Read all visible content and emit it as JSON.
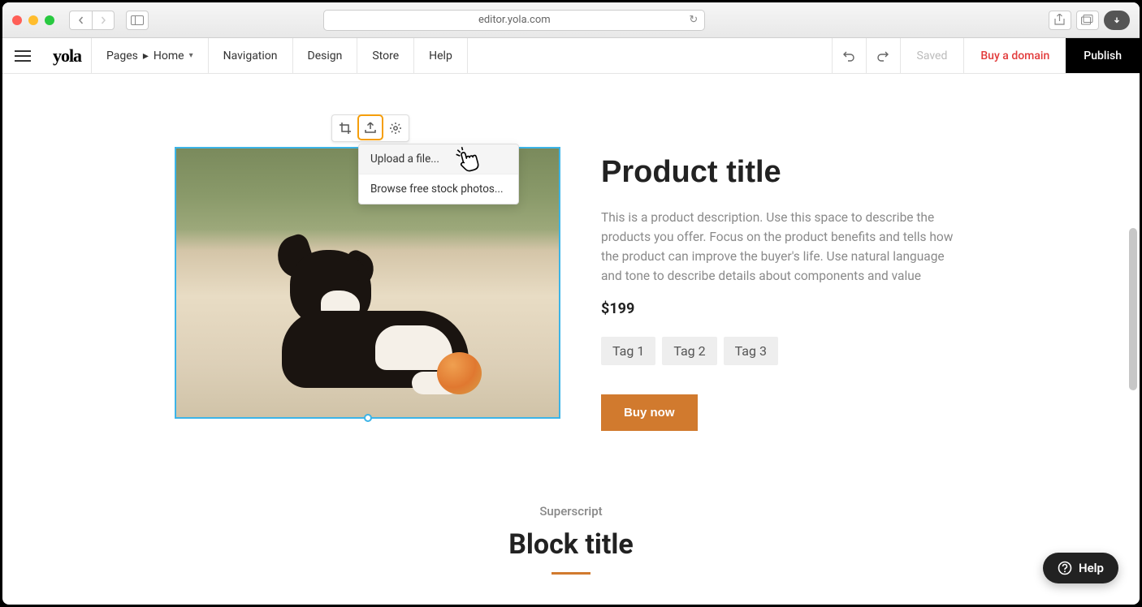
{
  "browser": {
    "url": "editor.yola.com"
  },
  "app": {
    "logo": "yola",
    "menu": {
      "pages": "Pages",
      "current_page": "Home",
      "navigation": "Navigation",
      "design": "Design",
      "store": "Store",
      "help": "Help"
    },
    "status": "Saved",
    "buy_domain": "Buy a domain",
    "publish": "Publish"
  },
  "image_toolbar": {
    "crop": "crop",
    "upload": "upload",
    "settings": "settings"
  },
  "dropdown": {
    "upload_file": "Upload a file...",
    "browse_stock": "Browse free stock photos..."
  },
  "product": {
    "title": "Product title",
    "description": "This is a product description. Use this space to describe the products you offer. Focus on the product benefits and tells how the product can improve the buyer's life. Use natural language and tone to describe details about components and value",
    "price": "$199",
    "tags": [
      "Tag 1",
      "Tag 2",
      "Tag 3"
    ],
    "buy_label": "Buy now"
  },
  "block": {
    "superscript": "Superscript",
    "title": "Block title"
  },
  "help_pill": "Help",
  "colors": {
    "accent": "#d17a2e",
    "selection": "#3cb4e7",
    "highlight": "#f59e0b",
    "danger": "#e23b3b"
  }
}
